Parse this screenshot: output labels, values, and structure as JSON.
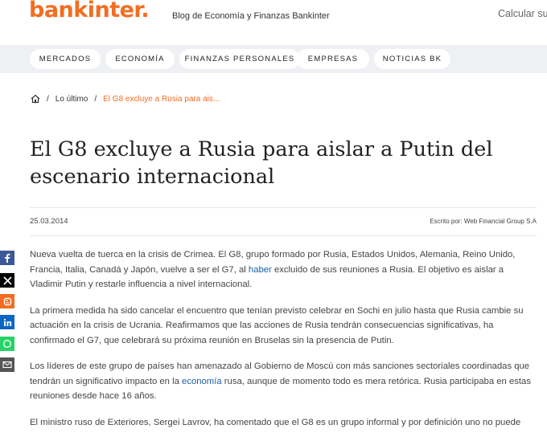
{
  "header": {
    "logo_text": "bankinter.",
    "blog_title": "Blog de Economía y Finanzas Bankinter",
    "calculator_text": "Calcular sue"
  },
  "nav": {
    "items": [
      "MERCADOS",
      "ECONOMÍA",
      "FINANZAS PERSONALES",
      "EMPRESAS",
      "NOTICIAS BK"
    ]
  },
  "breadcrumb": {
    "home_icon": "home-icon",
    "sep1": "/",
    "item1": "Lo último",
    "sep2": "/",
    "current": "El G8 excluye a Rusia para ais..."
  },
  "article": {
    "title": "El G8 excluye a Rusia para aislar a Putin del escenario internacional",
    "date": "25.03.2014",
    "author": "Escrito por: Web Financial Group S.A",
    "p1_before": "Nueva vuelta de tuerca en la crisis de Crimea. El G8, grupo formado por Rusia, Estados Unidos, Alemania, Reino Unido, Francia, Italia, Canadá y Japón, vuelve a ser el G7, al ",
    "p1_link": "haber",
    "p1_after": " excluido de sus reuniones a Rusia. El objetivo es aislar a Vladimir Putin y restarle influencia a nivel internacional.",
    "p2": "La primera medida ha sido cancelar el encuentro que tenían previsto celebrar en Sochi en julio hasta que Rusia cambie su actuación en la crisis de Ucrania. Reafirmamos que las acciones de Rusia tendrán consecuencias significativas, ha confirmado el G7, que celebrará su próxima reunión en Bruselas sin la presencia de Putin.",
    "p3_before": "Los líderes de este grupo de países han amenazado al Gobierno de Moscú con más sanciones sectoriales coordinadas que tendrán un significativo impacto en la ",
    "p3_link": "economía",
    "p3_after": " rusa, aunque de momento todo es mera retórica. Rusia participaba en estas reuniones desde hace 16 años.",
    "p4": "El ministro ruso de Exteriores, Sergei Lavrov, ha comentado que el G8 es un grupo informal y por definición uno no puede"
  },
  "share": {
    "icons": [
      "facebook-icon",
      "x-icon",
      "blogger-icon",
      "linkedin-icon",
      "whatsapp-icon",
      "email-icon"
    ]
  },
  "colors": {
    "brand": "#f26d21",
    "nav_bg": "#eef0f3",
    "link": "#1a5fa8",
    "facebook": "#3b5998",
    "x": "#000000",
    "blogger": "#f26d21",
    "linkedin": "#0a66c2",
    "whatsapp": "#25d366",
    "email": "#555555"
  }
}
